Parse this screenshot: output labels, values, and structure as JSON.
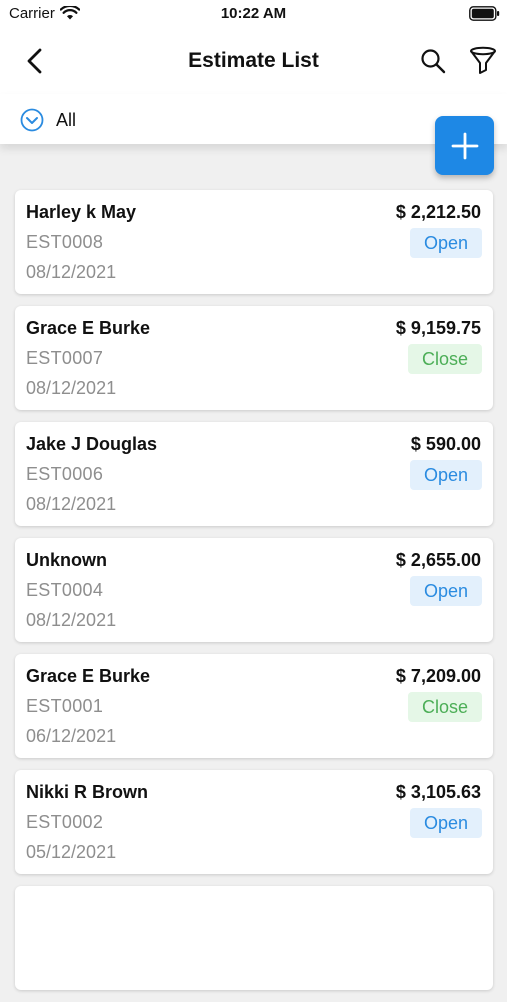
{
  "status_bar": {
    "carrier": "Carrier",
    "time": "10:22 AM"
  },
  "header": {
    "title": "Estimate List",
    "back_icon": "chevron-left-icon",
    "search_icon": "search-icon",
    "filter_icon": "funnel-icon"
  },
  "filter": {
    "selected": "All",
    "icon": "chevron-down-circle-icon"
  },
  "add_button": {
    "icon": "plus-icon"
  },
  "colors": {
    "accent": "#1e88e5",
    "open_badge_bg": "#e3f0fc",
    "open_badge_text": "#2a8be0",
    "close_badge_bg": "#e5f7e7",
    "close_badge_text": "#4cae57"
  },
  "estimates": [
    {
      "name": "Harley k May",
      "number": "EST0008",
      "date": "08/12/2021",
      "amount": "$ 2,212.50",
      "status": "Open"
    },
    {
      "name": "Grace E Burke",
      "number": "EST0007",
      "date": "08/12/2021",
      "amount": "$ 9,159.75",
      "status": "Close"
    },
    {
      "name": "Jake J Douglas",
      "number": "EST0006",
      "date": "08/12/2021",
      "amount": "$ 590.00",
      "status": "Open"
    },
    {
      "name": "Unknown",
      "number": "EST0004",
      "date": "08/12/2021",
      "amount": "$ 2,655.00",
      "status": "Open"
    },
    {
      "name": "Grace E Burke",
      "number": "EST0001",
      "date": "06/12/2021",
      "amount": "$ 7,209.00",
      "status": "Close"
    },
    {
      "name": "Nikki R Brown",
      "number": "EST0002",
      "date": "05/12/2021",
      "amount": "$ 3,105.63",
      "status": "Open"
    }
  ]
}
